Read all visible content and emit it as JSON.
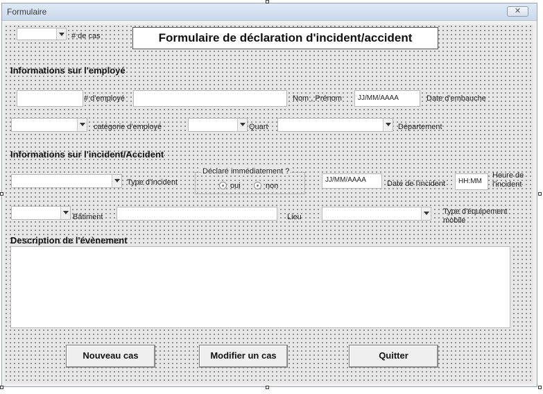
{
  "window": {
    "title": "Formulaire",
    "close": "✕"
  },
  "form_title": "Formulaire de déclaration d'incident/accident",
  "case": {
    "label": "# de cas"
  },
  "employee": {
    "heading": "Informations sur l'employé",
    "id_label": "# d'employé",
    "name_label": "Nom , Prénom",
    "hire_date_value": "JJ/MM/AAAA",
    "hire_date_label": "Date d'embauche",
    "category_label": "catégorie d'employé",
    "shift_label": "Quart",
    "department_label": "Département"
  },
  "incident": {
    "heading": "Informations sur l'incident/Accident",
    "type_label": "Type d'incident",
    "declared_label": "Déclaré immédiatement ?",
    "yes_label": "oui",
    "no_label": "non",
    "date_value": "JJ/MM/AAAA",
    "date_label": "Date de l'incident",
    "time_value": "HH:MM",
    "time_label": "Heure de l'incident",
    "building_label": "Bâtiment",
    "location_label": "Lieu",
    "equipment_label": "Type d'équipement mobile"
  },
  "description": {
    "heading": "Description de l'évènement"
  },
  "buttons": {
    "new_case": "Nouveau cas",
    "edit_case": "Modifier un cas",
    "quit": "Quitter"
  }
}
